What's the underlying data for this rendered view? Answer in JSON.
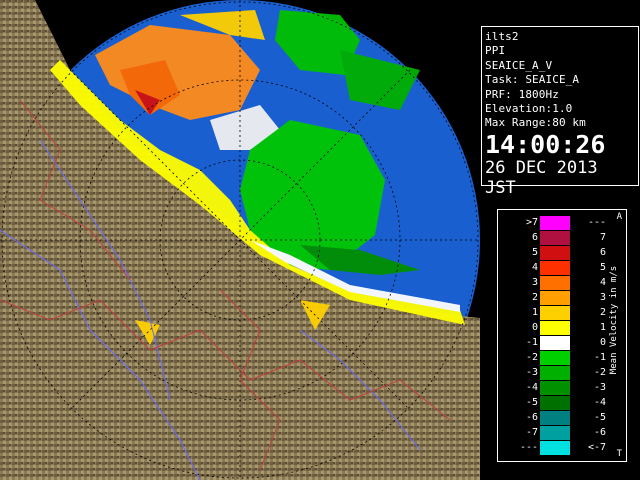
{
  "radar": {
    "lines": [
      "ilts2",
      "PPI",
      "SEAICE_A_V",
      "Task: SEAICE_A",
      "PRF: 1800Hz",
      "Elevation:1.0",
      "Max Range:80 km"
    ],
    "time": "14:00:26",
    "date": "26 DEC 2013 JST"
  },
  "legend": {
    "unit": "Mean Velocity in m/s",
    "corner_top": "A",
    "corner_bottom": "T",
    "rows": [
      {
        "left": ">7",
        "right": "---",
        "color": "#ff00ff"
      },
      {
        "left": "6",
        "right": "7",
        "color": "#b01040"
      },
      {
        "left": "5",
        "right": "6",
        "color": "#d01010"
      },
      {
        "left": "4",
        "right": "5",
        "color": "#ff3000"
      },
      {
        "left": "3",
        "right": "4",
        "color": "#ff7000"
      },
      {
        "left": "2",
        "right": "3",
        "color": "#ffa000"
      },
      {
        "left": "1",
        "right": "2",
        "color": "#ffd000"
      },
      {
        "left": "0",
        "right": "1",
        "color": "#ffff00"
      },
      {
        "left": "-1",
        "right": "0",
        "color": "#ffffff"
      },
      {
        "left": "-2",
        "right": "-1",
        "color": "#00d000"
      },
      {
        "left": "-3",
        "right": "-2",
        "color": "#00b000"
      },
      {
        "left": "-4",
        "right": "-3",
        "color": "#009000"
      },
      {
        "left": "-5",
        "right": "-4",
        "color": "#007000"
      },
      {
        "left": "-6",
        "right": "-5",
        "color": "#008080"
      },
      {
        "left": "-7",
        "right": "-6",
        "color": "#00a0a0"
      },
      {
        "left": "---",
        "right": "<-7",
        "color": "#00e0e0"
      }
    ]
  },
  "colors": {
    "sea": "#1a5fd0",
    "land": "#8a7a55"
  }
}
